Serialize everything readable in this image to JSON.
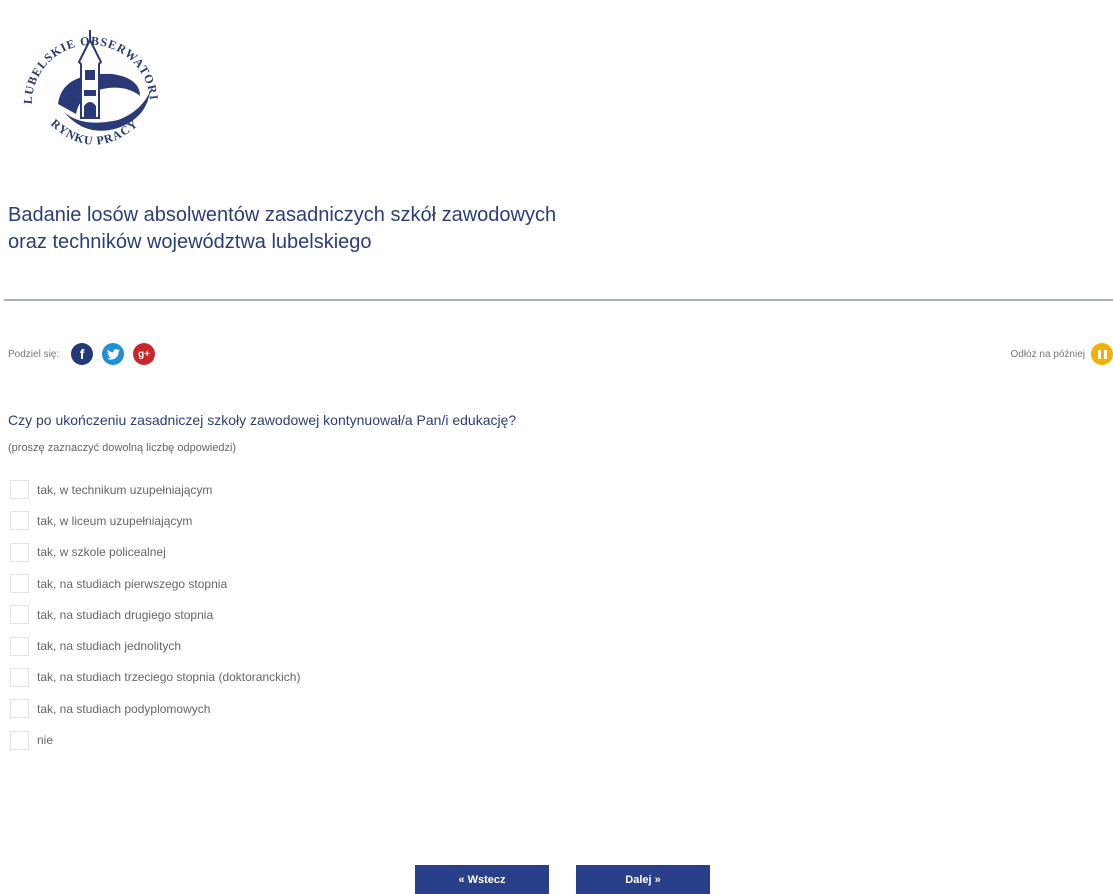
{
  "logo": {
    "top_text": "LUBELSKIE OBSERWATORIUM",
    "bottom_text": "RYNKU PRACY",
    "color": "#2a3a78"
  },
  "title": "Badanie losów absolwentów zasadniczych szkół zawodowych oraz techników województwa lubelskiego",
  "share": {
    "label": "Podziel się:",
    "facebook_glyph": "f",
    "twitter_glyph": "t",
    "googleplus_glyph": "g+"
  },
  "later": {
    "label": "Odłóż na później"
  },
  "question": {
    "text": "Czy po ukończeniu zasadniczej szkoły zawodowej kontynuował/a Pan/i edukację?",
    "hint": "(proszę zaznaczyć dowolną liczbę odpowiedzi)",
    "options": [
      {
        "label": "tak, w technikum uzupełniającym",
        "checked": false
      },
      {
        "label": "tak, w liceum uzupełniającym",
        "checked": false
      },
      {
        "label": "tak, w szkole policealnej",
        "checked": false
      },
      {
        "label": "tak, na studiach pierwszego stopnia",
        "checked": false
      },
      {
        "label": "tak, na studiach drugiego stopnia",
        "checked": false
      },
      {
        "label": "tak, na studiach jednolitych",
        "checked": false
      },
      {
        "label": "tak, na studiach trzeciego stopnia (doktoranckich)",
        "checked": false
      },
      {
        "label": "tak, na studiach podyplomowych",
        "checked": false
      },
      {
        "label": "nie",
        "checked": false
      }
    ]
  },
  "nav": {
    "back_label": "« Wstecz",
    "next_label": "Dalej »"
  },
  "colors": {
    "primary": "#2a3f8a",
    "title_text": "#2a3e7a",
    "facebook": "#24397a",
    "twitter": "#1e8fd8",
    "googleplus": "#c8262a",
    "pause": "#f2b100"
  },
  "icons": [
    "facebook-icon",
    "twitter-icon",
    "googleplus-icon",
    "pause-icon",
    "logo-tower-icon"
  ]
}
